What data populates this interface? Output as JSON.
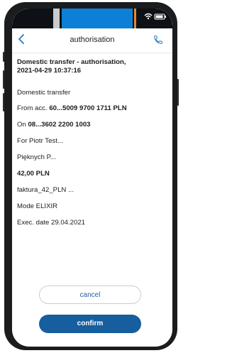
{
  "nav": {
    "title": "authorisation"
  },
  "details": {
    "header_line1": "Domestic transfer - authorisation,",
    "header_line2": "2021-04-29 10:37:16",
    "type": "Domestic transfer",
    "from_prefix": "From acc. ",
    "from_account": "60...5009 9700 1711 PLN",
    "on_prefix": "On ",
    "on_account": "08...3602 2200 1003",
    "recipient": "For Piotr Test...",
    "address": "Pięknych P...",
    "amount": "42,00 PLN",
    "title": "faktura_42_PLN ...",
    "mode": "Mode ELIXIR",
    "exec_date": "Exec. date 29.04.2021"
  },
  "buttons": {
    "cancel": "cancel",
    "confirm": "confirm"
  },
  "icons": {
    "back": "chevron-left-icon",
    "phone": "phone-icon",
    "wifi": "wifi-icon",
    "battery": "battery-icon"
  },
  "colors": {
    "accent": "#165e9e",
    "link": "#2b7bc4"
  }
}
